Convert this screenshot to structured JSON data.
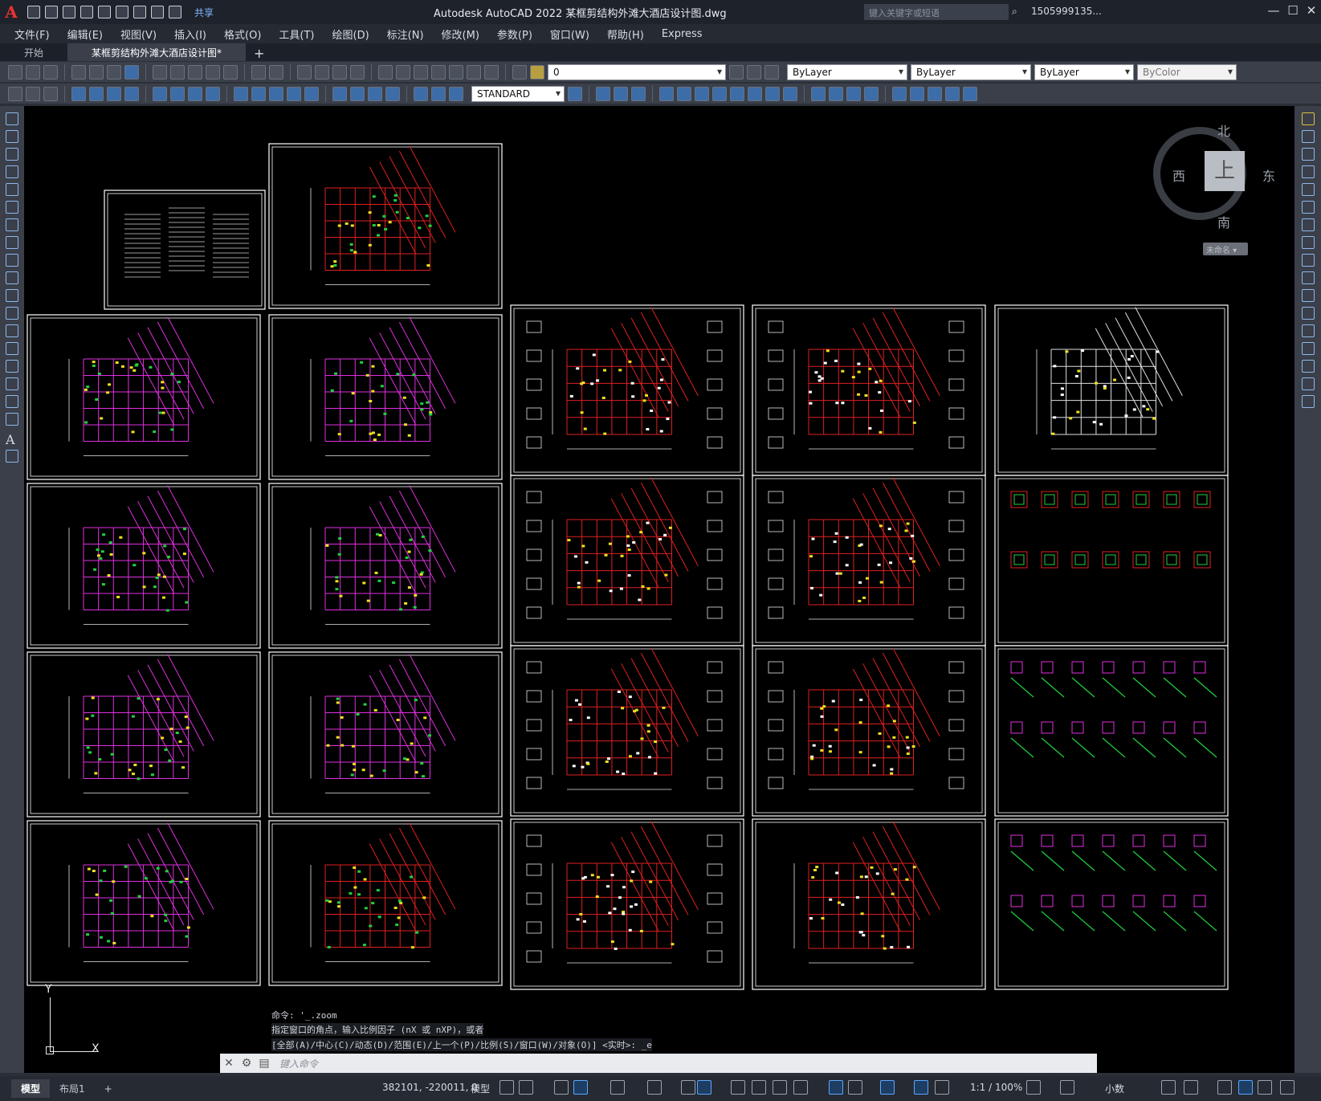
{
  "window": {
    "title": "Autodesk AutoCAD 2022    某框剪结构外滩大酒店设计图.dwg",
    "app_logo": "A",
    "search_placeholder": "键入关键字或短语",
    "user": "1505999135...",
    "share": "共享",
    "controls": {
      "minimize": "—",
      "maximize": "☐",
      "close": "✕"
    }
  },
  "menu": [
    "文件(F)",
    "编辑(E)",
    "视图(V)",
    "插入(I)",
    "格式(O)",
    "工具(T)",
    "绘图(D)",
    "标注(N)",
    "修改(M)",
    "参数(P)",
    "窗口(W)",
    "帮助(H)",
    "Express"
  ],
  "tabs": [
    {
      "label": "开始",
      "active": false
    },
    {
      "label": "某框剪结构外滩大酒店设计图*",
      "active": true
    }
  ],
  "tab_add": "+",
  "toolbar": {
    "layer": "0",
    "color": "ByLayer",
    "linetype": "ByLayer",
    "lineweight": "ByLayer",
    "plotstyle": "ByColor",
    "textstyle": "STANDARD"
  },
  "viewcube": {
    "north": "北",
    "south": "南",
    "east": "东",
    "west": "西",
    "face": "上",
    "wcs": "未命名 ▾"
  },
  "command": {
    "history": [
      "命令: '_.zoom",
      "指定窗口的角点，输入比例因子 (nX 或 nXP)，或者",
      "[全部(A)/中心(C)/动态(D)/范围(E)/上一个(P)/比例(S)/窗口(W)/对象(O)] <实时>: _e"
    ],
    "placeholder": "键入命令"
  },
  "ucs": {
    "x": "X",
    "y": "Y"
  },
  "status": {
    "layout_tabs": [
      {
        "label": "模型",
        "active": true
      },
      {
        "label": "布局1",
        "active": false
      }
    ],
    "add": "+",
    "coords": "382101, -220011, 0",
    "model": "模型",
    "scale": "1:1 / 100%",
    "units": "小数"
  },
  "colors": {
    "canvas": "#000000",
    "frame": "#ffffff",
    "grid_red": "#e02020",
    "magenta": "#e030e0",
    "yellow": "#f0e020",
    "green": "#20d040"
  }
}
